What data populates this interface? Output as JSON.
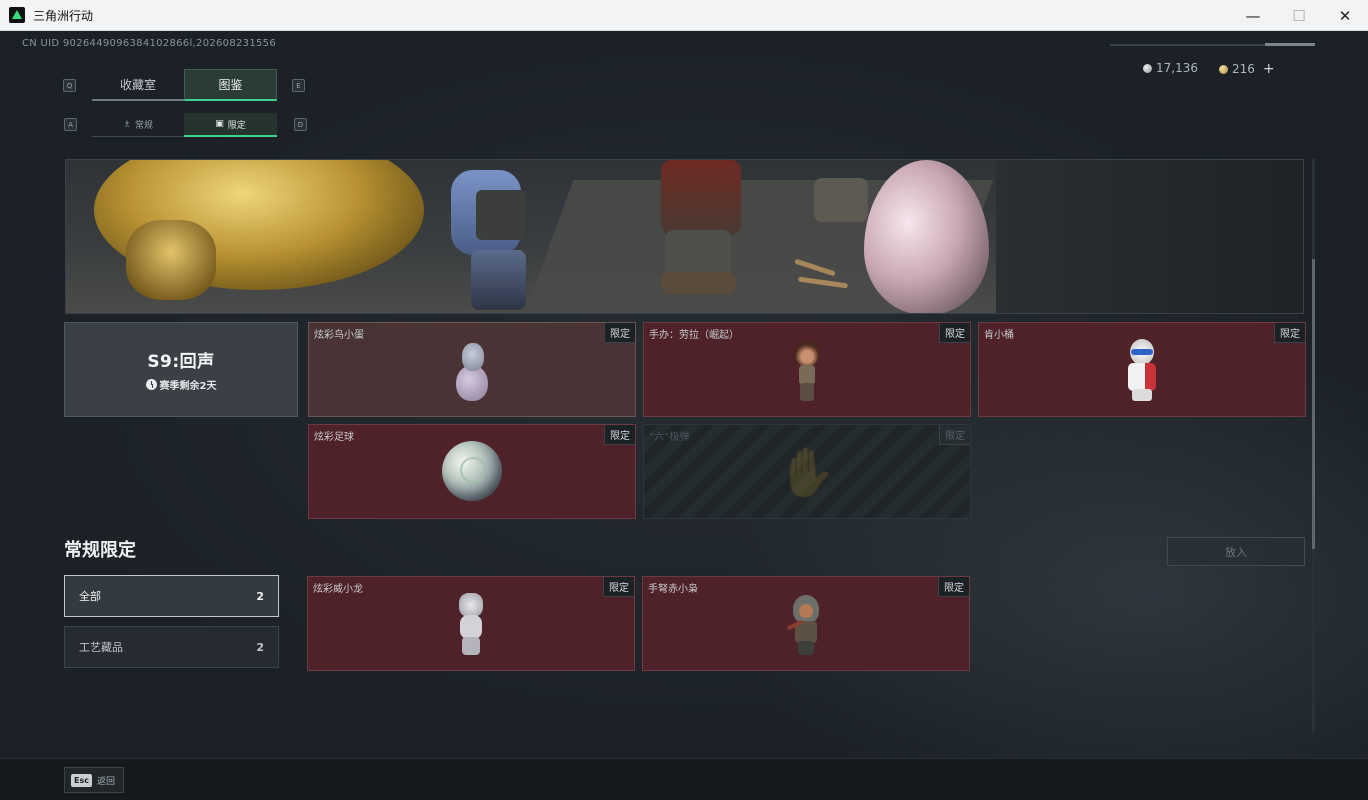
{
  "window": {
    "title": "三角洲行动",
    "minimize": "—",
    "maximize": "☐",
    "close": "✕"
  },
  "header": {
    "uid": "CN UID 9026449096384102866l,202608231556",
    "currency_silver": "17,136",
    "currency_gold": "216",
    "add_label": "+"
  },
  "tabs": {
    "key_left": "Q",
    "key_right": "E",
    "items": [
      {
        "label": "收藏室"
      },
      {
        "label": "图鉴"
      }
    ],
    "active_index": 1
  },
  "subtabs": {
    "key_left": "A",
    "key_right": "D",
    "items": [
      {
        "label": "常规",
        "icon": "bottle-icon"
      },
      {
        "label": "限定",
        "icon": "image-icon"
      }
    ],
    "active_index": 1
  },
  "season": {
    "title": "S9:回声",
    "remaining": "赛季剩余2天"
  },
  "season_items": [
    {
      "name": "炫彩鸟小蛋",
      "tag": "限定",
      "figure": "egg-chick"
    },
    {
      "name": "手办：劳拉（崛起）",
      "tag": "限定",
      "figure": "lara-figure"
    },
    {
      "name": "肯小桶",
      "tag": "限定",
      "figure": "colonel-figure"
    },
    {
      "name": "炫彩足球",
      "tag": "限定",
      "figure": "soccer-ball"
    },
    {
      "name": "“六”极弹",
      "tag": "限定",
      "figure": "locked",
      "locked": true
    }
  ],
  "section": {
    "title": "常规限定",
    "filters": [
      {
        "label": "全部",
        "count": "2"
      },
      {
        "label": "工艺藏品",
        "count": "2"
      }
    ],
    "place_button": "放入",
    "items": [
      {
        "name": "炫彩威小龙",
        "tag": "限定",
        "figure": "dragon-figure"
      },
      {
        "name": "手弩赤小枭",
        "tag": "限定",
        "figure": "crossbow-figure"
      }
    ]
  },
  "footer": {
    "esc_key": "Esc",
    "back_label": "返回"
  }
}
